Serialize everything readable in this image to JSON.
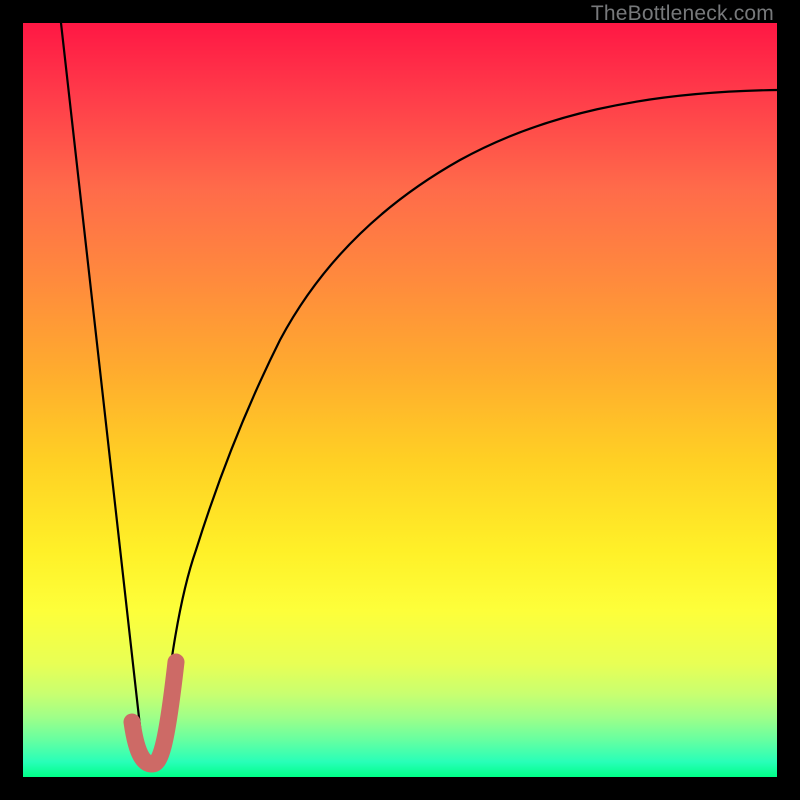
{
  "watermark": "TheBottleneck.com",
  "chart_data": {
    "type": "line",
    "title": "",
    "xlabel": "",
    "ylabel": "",
    "xlim": [
      0,
      100
    ],
    "ylim": [
      0,
      100
    ],
    "background": "heatmap-gradient (red high to green low)",
    "series": [
      {
        "name": "left-descending-line",
        "style": "thin-black",
        "points": [
          {
            "x": 5.0,
            "y": 100
          },
          {
            "x": 16.0,
            "y": 2
          }
        ]
      },
      {
        "name": "right-ascending-curve",
        "style": "thin-black",
        "points": [
          {
            "x": 18.0,
            "y": 2
          },
          {
            "x": 20.3,
            "y": 15
          },
          {
            "x": 23.0,
            "y": 30
          },
          {
            "x": 27.0,
            "y": 46
          },
          {
            "x": 32.0,
            "y": 60
          },
          {
            "x": 40.0,
            "y": 72
          },
          {
            "x": 50.0,
            "y": 80
          },
          {
            "x": 62.0,
            "y": 85
          },
          {
            "x": 78.0,
            "y": 88.5
          },
          {
            "x": 100.0,
            "y": 91
          }
        ]
      },
      {
        "name": "j-hook-marker",
        "style": "thick-salmon",
        "points": [
          {
            "x": 14.5,
            "y": 6
          },
          {
            "x": 15.5,
            "y": 2.5
          },
          {
            "x": 17.0,
            "y": 2
          },
          {
            "x": 18.5,
            "y": 3
          },
          {
            "x": 20.3,
            "y": 15
          }
        ]
      }
    ]
  }
}
